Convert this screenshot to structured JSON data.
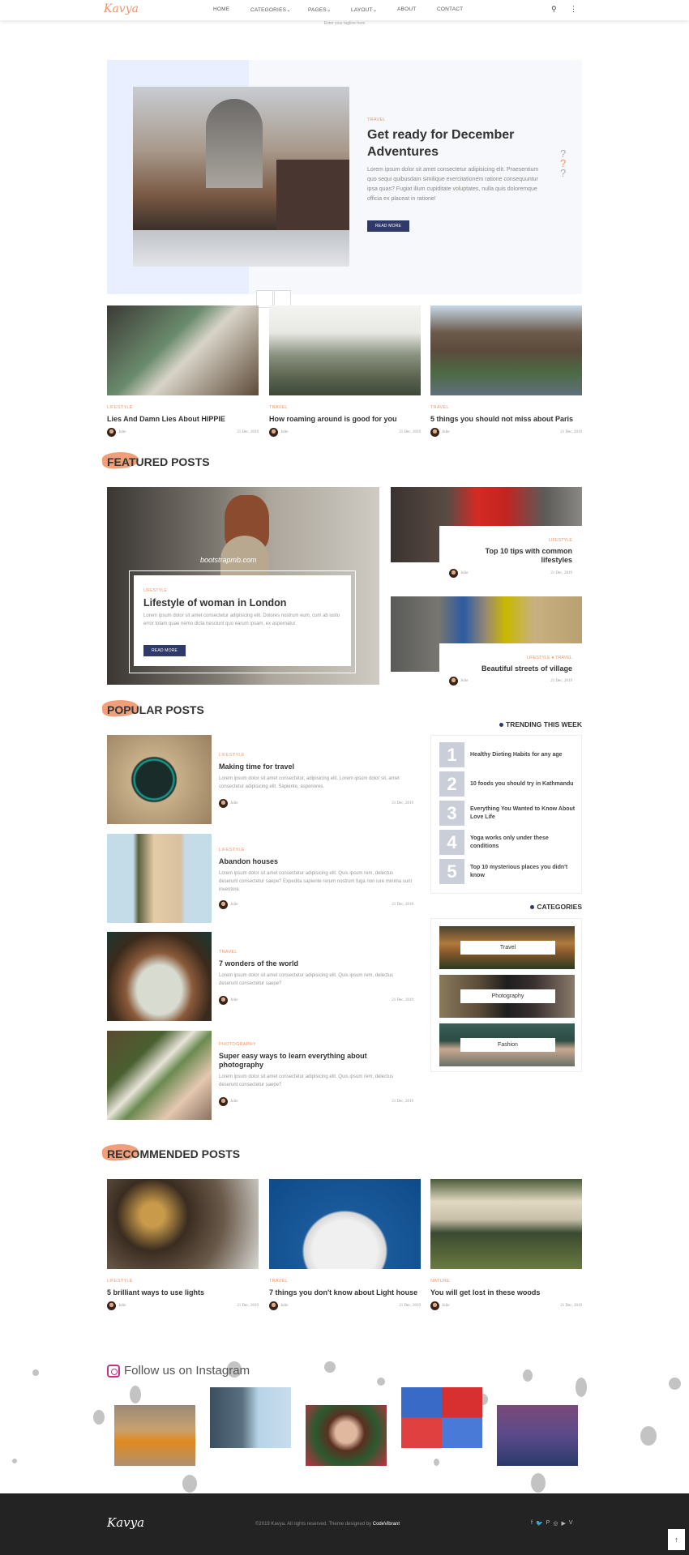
{
  "nav": {
    "logo": "Kavya",
    "items": [
      "HOME",
      "CATEGORIES⌄",
      "PAGES⌄",
      "LAYOUT⌄",
      "ABOUT",
      "CONTACT"
    ],
    "tagline": "Enter your tagline here"
  },
  "hero": {
    "category": "TRAVEL",
    "title": "Get ready for December Adventures",
    "text": "Lorem ipsum dolor sit amet consectetur adipisicing elit. Praesentium quo sequi quibusdam similique exercitationem ratione consequuntur ipsa quas? Fugiat illum cupiditate voluptates, nulla quis doloremque officia ex placeat in ratione!",
    "button": "READ MORE",
    "slider_icons": [
      "?",
      "?",
      "?"
    ]
  },
  "top_cards": [
    {
      "category": "LIFESTYLE",
      "title": "Lies And Damn Lies About HIPPIE",
      "author": "Julie",
      "date": "21 Dec, 2019"
    },
    {
      "category": "TRAVEL",
      "title": "How roaming around is good for you",
      "author": "Julie",
      "date": "21 Dec, 2019"
    },
    {
      "category": "TRAVEL",
      "title": "5 things you should not miss about Paris",
      "author": "Julie",
      "date": "21 Dec, 2019"
    }
  ],
  "featured": {
    "heading": "FEATURED POSTS",
    "main": {
      "watermark": "bootstrapmb.com",
      "category": "LIFESTYLE",
      "title": "Lifestyle of woman in London",
      "text": "Lorem ipsum dolor sit amet consectetur adipisicing elit. Dolores nostrum eum, cum ab iusto error totam quae nemo dicta nesciunt quo earum ipsam, ex aspernatur.",
      "button": "READ MORE"
    },
    "side": [
      {
        "category": "LIFESTYLE",
        "title": "Top 10 tips with common lifestyles",
        "author": "Julie",
        "date": "21 Dec, 2019"
      },
      {
        "category": "LIFESTYLE ● TRAVEL",
        "title": "Beautiful streets of village",
        "author": "Julie",
        "date": "21 Dec, 2019"
      }
    ]
  },
  "popular": {
    "heading": "POPULAR POSTS",
    "posts": [
      {
        "category": "LIFESTYLE",
        "title": "Making time for travel",
        "text": "Lorem ipsum dolor sit amet consectetur, adipisicing elit. Lorem ipsum dolor sit, amet consectetur adipisicing elit. Sapiente, asperiores.",
        "author": "Julie",
        "date": "21 Dec, 2019"
      },
      {
        "category": "LIFESTYLE",
        "title": "Abandon houses",
        "text": "Lorem ipsum dolor sit amet consectetur adipisicing elit. Quis ipsum rem, delectus deserunt consectetur saepe? Expedita sapiente rerum nostrum fuga non iure minima sunt inventore.",
        "author": "Julie",
        "date": "21 Dec, 2019"
      },
      {
        "category": "TRAVEL",
        "title": "7 wonders of the world",
        "text": "Lorem ipsum dolor sit amet consectetur adipisicing elit. Quis ipsum rem, delectus deserunt consectetur saepe?",
        "author": "Julie",
        "date": "21 Dec, 2019"
      },
      {
        "category": "PHOTOGRAPHY",
        "title": "Super easy ways to learn everything about photography",
        "text": "Lorem ipsum dolor sit amet consectetur adipisicing elit. Quis ipsum rem, delectus deserunt consectetur saepe?",
        "author": "Julie",
        "date": "21 Dec, 2019"
      }
    ]
  },
  "trending": {
    "heading": "TRENDING THIS WEEK",
    "items": [
      {
        "num": "1",
        "title": "Healthy Dieting Habits for any age"
      },
      {
        "num": "2",
        "title": "10 foods you should try in Kathmandu"
      },
      {
        "num": "3",
        "title": "Everything You Wanted to Know About Love Life"
      },
      {
        "num": "4",
        "title": "Yoga works only under these conditions"
      },
      {
        "num": "5",
        "title": "Top 10 mysterious places you didn't know"
      }
    ]
  },
  "categories": {
    "heading": "CATEGORIES",
    "items": [
      "Travel",
      "Photography",
      "Fashion"
    ]
  },
  "recommended": {
    "heading": "RECOMMENDED POSTS",
    "posts": [
      {
        "category": "LIFESTYLE",
        "title": "5 brilliant ways to use lights",
        "author": "Julie",
        "date": "21 Dec, 2019"
      },
      {
        "category": "TRAVEL",
        "title": "7 things you don't know about Light house",
        "author": "Julie",
        "date": "21 Dec, 2019"
      },
      {
        "category": "NATURE",
        "title": "You will get lost in these woods",
        "author": "Julie",
        "date": "21 Dec, 2019"
      }
    ]
  },
  "instagram": {
    "heading": "Follow us on Instagram"
  },
  "footer": {
    "logo": "Kavya",
    "copyright": "©2019 Kavya. All rights reserved. Theme designed by ",
    "designer": "CodeVibrant",
    "social": [
      "f",
      "🐦",
      "P",
      "◎",
      "▶",
      "V"
    ],
    "to_top": "↑"
  },
  "colors": {
    "accent": "#f0956b",
    "button": "#2f3a6b",
    "footer": "#232323"
  }
}
